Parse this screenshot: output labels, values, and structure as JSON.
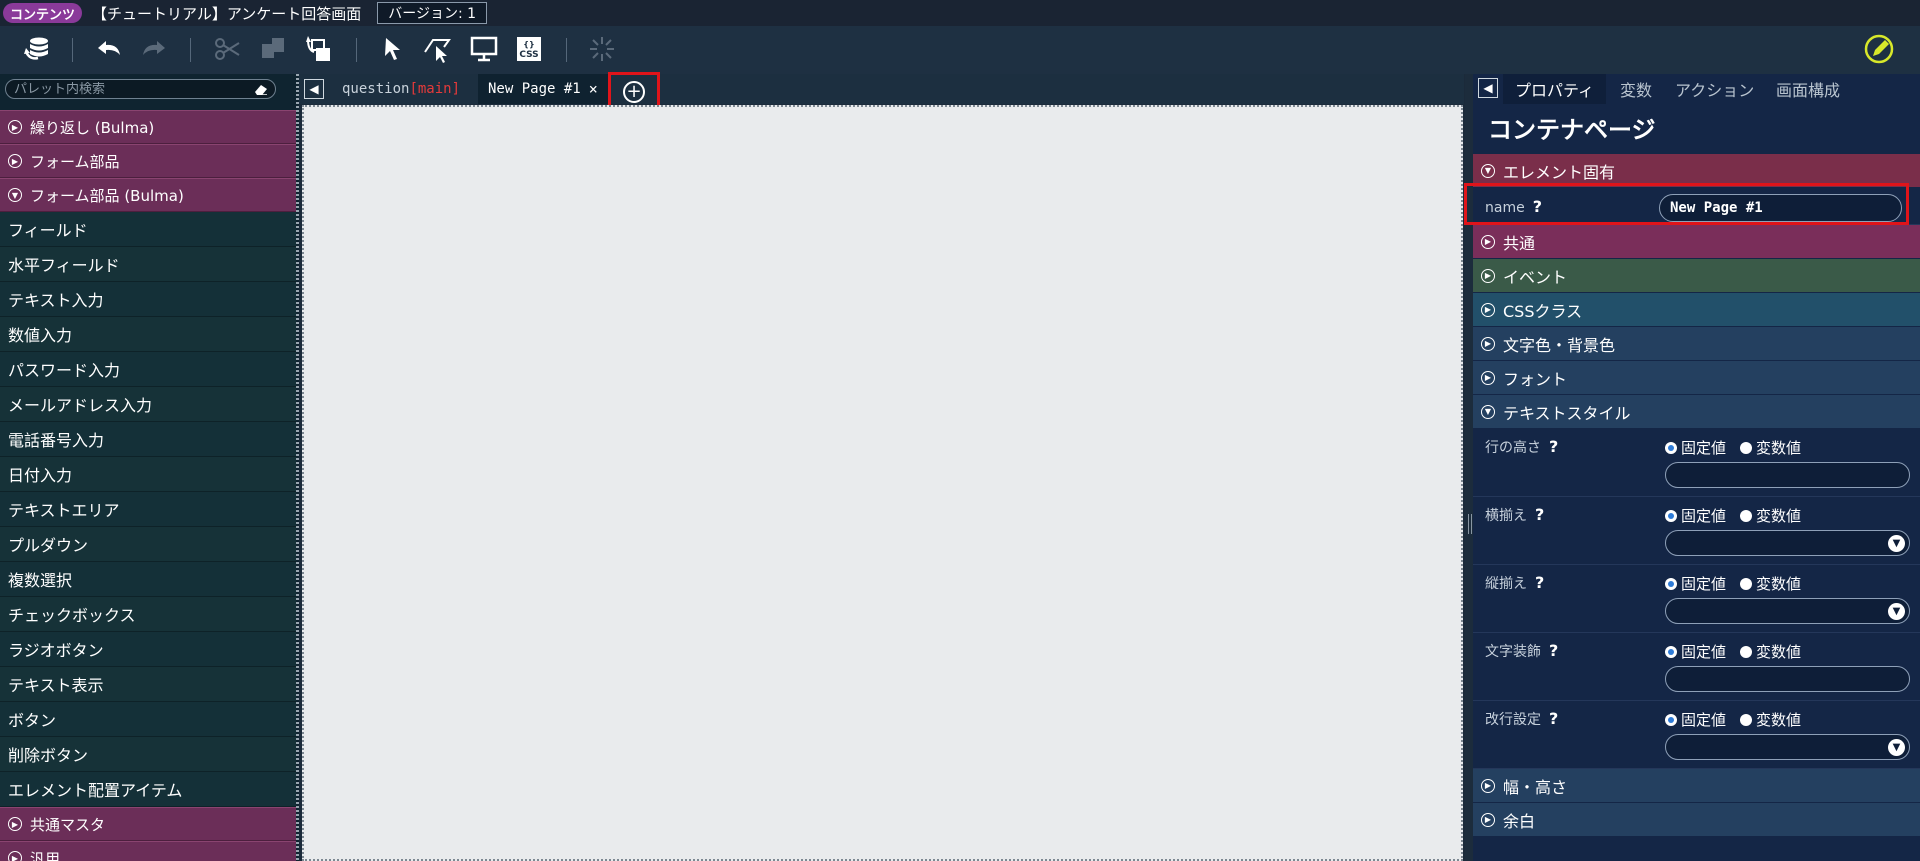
{
  "titlebar": {
    "badge": "コンテンツ",
    "title": "【チュートリアル】アンケート回答画面",
    "version": "バージョン: 1"
  },
  "toolbar": {
    "buttons": [
      "database-icon",
      "undo-icon",
      "redo-icon",
      "cut-icon",
      "copy-icon",
      "paste-icon",
      "select-icon",
      "multiselect-icon",
      "monitor-icon",
      "css-icon",
      "loading-icon",
      "edit-icon"
    ]
  },
  "palette": {
    "search_placeholder": "パレット内検索",
    "categories_top": [
      {
        "label": "繰り返し (Bulma)",
        "expanded": false
      },
      {
        "label": "フォーム部品",
        "expanded": false
      },
      {
        "label": "フォーム部品 (Bulma)",
        "expanded": true
      }
    ],
    "items": [
      "フィールド",
      "水平フィールド",
      "テキスト入力",
      "数値入力",
      "パスワード入力",
      "メールアドレス入力",
      "電話番号入力",
      "日付入力",
      "テキストエリア",
      "プルダウン",
      "複数選択",
      "チェックボックス",
      "ラジオボタン",
      "テキスト表示",
      "ボタン",
      "削除ボタン",
      "エレメント配置アイテム"
    ],
    "categories_bottom": [
      {
        "label": "共通マスタ",
        "expanded": false
      },
      {
        "label": "汎用",
        "expanded": false
      }
    ]
  },
  "tabs": {
    "tab1_name": "question",
    "tab1_suffix": "[main]",
    "tab2_name": "New Page #1",
    "close_glyph": "×",
    "add_glyph": "+"
  },
  "properties": {
    "tabs": [
      "プロパティ",
      "変数",
      "アクション",
      "画面構成"
    ],
    "active_tab": "プロパティ",
    "title": "コンテナページ",
    "sections": {
      "element_specific": "エレメント固有",
      "common": "共通",
      "event": "イベント",
      "css_class": "CSSクラス",
      "color": "文字色・背景色",
      "font": "フォント",
      "text_style": "テキストスタイル",
      "size": "幅・高さ",
      "margin": "余白"
    },
    "name_label": "name",
    "name_value": "New Page #1",
    "fixed_label": "固定値",
    "variable_label": "変数値",
    "rows": [
      {
        "label": "行の高さ",
        "type": "text"
      },
      {
        "label": "横揃え",
        "type": "select"
      },
      {
        "label": "縦揃え",
        "type": "select"
      },
      {
        "label": "文字装飾",
        "type": "text"
      },
      {
        "label": "改行設定",
        "type": "select"
      }
    ]
  },
  "colors": {
    "category_bg": "#6b2e58",
    "highlight_red": "#e0141a",
    "canvas_bg": "#e9ebed",
    "common_section": "#7a2e5a",
    "event_section": "#3a5a48",
    "css_section": "#22506a",
    "style_section": "#244060"
  }
}
